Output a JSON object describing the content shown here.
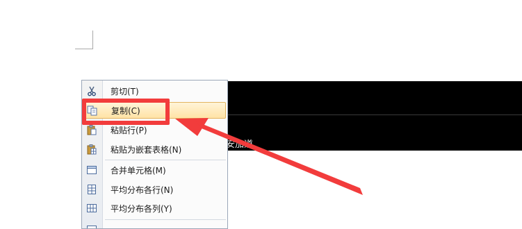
{
  "document": {
    "cell_text": "安加道"
  },
  "context_menu": {
    "items": [
      {
        "label": "剪切(T)",
        "icon": "scissors-icon",
        "highlighted": false
      },
      {
        "label": "复制(C)",
        "icon": "copy-icon",
        "highlighted": true
      },
      {
        "label": "粘贴行(P)",
        "icon": "paste-icon",
        "highlighted": false
      },
      {
        "label": "粘贴为嵌套表格(N)",
        "icon": "paste-nested-table-icon",
        "highlighted": false
      },
      {
        "label": "合并单元格(M)",
        "icon": "merge-cells-icon",
        "highlighted": false
      },
      {
        "label": "平均分布各行(N)",
        "icon": "distribute-rows-icon",
        "highlighted": false
      },
      {
        "label": "平均分布各列(Y)",
        "icon": "distribute-columns-icon",
        "highlighted": false
      }
    ]
  },
  "annotation": {
    "highlight_color": "#f23c3c",
    "arrow_color": "#f23c3c"
  }
}
